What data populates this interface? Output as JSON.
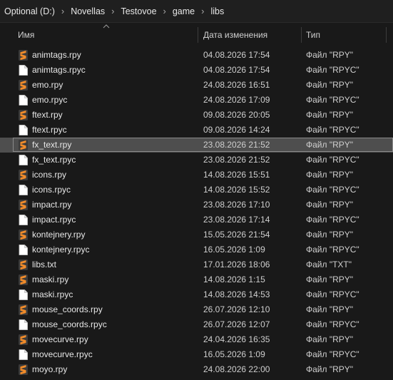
{
  "breadcrumb": [
    "Optional (D:)",
    "Novellas",
    "Testovoe",
    "game",
    "libs"
  ],
  "columns": {
    "name": "Имя",
    "date": "Дата изменения",
    "type": "Тип"
  },
  "sort": {
    "column": "name",
    "direction": "ascending"
  },
  "colors": {
    "sublime_orange": "#f28c2a",
    "selection": "#4e4e4e",
    "background": "#191919"
  },
  "files": [
    {
      "name": "animtags.rpy",
      "date": "04.08.2026 17:54",
      "type": "Файл \"RPY\"",
      "icon": "sublime-file-icon"
    },
    {
      "name": "animtags.rpyc",
      "date": "04.08.2026 17:54",
      "type": "Файл \"RPYC\"",
      "icon": "blank-file-icon"
    },
    {
      "name": "emo.rpy",
      "date": "24.08.2026 16:51",
      "type": "Файл \"RPY\"",
      "icon": "sublime-file-icon"
    },
    {
      "name": "emo.rpyc",
      "date": "24.08.2026 17:09",
      "type": "Файл \"RPYC\"",
      "icon": "blank-file-icon"
    },
    {
      "name": "ftext.rpy",
      "date": "09.08.2026 20:05",
      "type": "Файл \"RPY\"",
      "icon": "sublime-file-icon"
    },
    {
      "name": "ftext.rpyc",
      "date": "09.08.2026 14:24",
      "type": "Файл \"RPYC\"",
      "icon": "blank-file-icon"
    },
    {
      "name": "fx_text.rpy",
      "date": "23.08.2026 21:52",
      "type": "Файл \"RPY\"",
      "icon": "sublime-file-icon",
      "selected": true
    },
    {
      "name": "fx_text.rpyc",
      "date": "23.08.2026 21:52",
      "type": "Файл \"RPYC\"",
      "icon": "blank-file-icon"
    },
    {
      "name": "icons.rpy",
      "date": "14.08.2026 15:51",
      "type": "Файл \"RPY\"",
      "icon": "sublime-file-icon"
    },
    {
      "name": "icons.rpyc",
      "date": "14.08.2026 15:52",
      "type": "Файл \"RPYC\"",
      "icon": "blank-file-icon"
    },
    {
      "name": "impact.rpy",
      "date": "23.08.2026 17:10",
      "type": "Файл \"RPY\"",
      "icon": "sublime-file-icon"
    },
    {
      "name": "impact.rpyc",
      "date": "23.08.2026 17:14",
      "type": "Файл \"RPYC\"",
      "icon": "blank-file-icon"
    },
    {
      "name": "kontejnery.rpy",
      "date": "15.05.2026 21:54",
      "type": "Файл \"RPY\"",
      "icon": "sublime-file-icon"
    },
    {
      "name": "kontejnery.rpyc",
      "date": "16.05.2026 1:09",
      "type": "Файл \"RPYC\"",
      "icon": "blank-file-icon"
    },
    {
      "name": "libs.txt",
      "date": "17.01.2026 18:06",
      "type": "Файл \"TXT\"",
      "icon": "sublime-file-icon"
    },
    {
      "name": "maski.rpy",
      "date": "14.08.2026 1:15",
      "type": "Файл \"RPY\"",
      "icon": "sublime-file-icon"
    },
    {
      "name": "maski.rpyc",
      "date": "14.08.2026 14:53",
      "type": "Файл \"RPYC\"",
      "icon": "blank-file-icon"
    },
    {
      "name": "mouse_coords.rpy",
      "date": "26.07.2026 12:10",
      "type": "Файл \"RPY\"",
      "icon": "sublime-file-icon"
    },
    {
      "name": "mouse_coords.rpyc",
      "date": "26.07.2026 12:07",
      "type": "Файл \"RPYC\"",
      "icon": "blank-file-icon"
    },
    {
      "name": "movecurve.rpy",
      "date": "24.04.2026 16:35",
      "type": "Файл \"RPY\"",
      "icon": "sublime-file-icon"
    },
    {
      "name": "movecurve.rpyc",
      "date": "16.05.2026 1:09",
      "type": "Файл \"RPYC\"",
      "icon": "blank-file-icon"
    },
    {
      "name": "moyo.rpy",
      "date": "24.08.2026 22:00",
      "type": "Файл \"RPY\"",
      "icon": "sublime-file-icon"
    }
  ]
}
